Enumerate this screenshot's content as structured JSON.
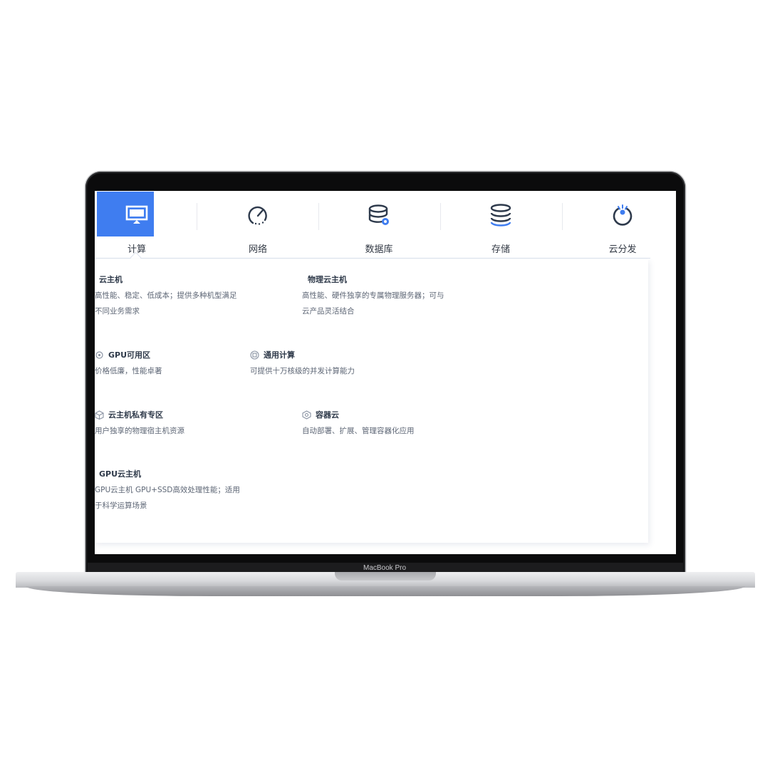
{
  "device": {
    "label": "MacBook Pro"
  },
  "tabs": [
    {
      "label": "计算",
      "icon": "monitor-icon",
      "active": true
    },
    {
      "label": "网络",
      "icon": "gauge-icon",
      "active": false
    },
    {
      "label": "数据库",
      "icon": "database-icon",
      "active": false
    },
    {
      "label": "存储",
      "icon": "storage-icon",
      "active": false
    },
    {
      "label": "云分发",
      "icon": "power-icon",
      "active": false
    }
  ],
  "products": {
    "cvm": {
      "title": "云主机",
      "desc1": "高性能、稳定、低成本；提供多种机型满足",
      "desc2": "不同业务需求"
    },
    "bare_metal": {
      "title": "物理云主机",
      "desc1": "高性能、硬件独享的专属物理服务器；可与",
      "desc2": "云产品灵活结合"
    },
    "gpu_zone": {
      "title": "GPU可用区",
      "desc": "价格低廉，性能卓著",
      "icon": "chip-icon"
    },
    "general_compute": {
      "title": "通用计算",
      "desc": "可提供十万核级的并发计算能力",
      "icon": "cpu-icon"
    },
    "private_zone": {
      "title": "云主机私有专区",
      "desc": "用户独享的物理宿主机资源",
      "icon": "cube-icon"
    },
    "container": {
      "title": "容器云",
      "desc": "自动部署、扩展、管理容器化应用",
      "icon": "container-icon"
    },
    "gpu_cvm": {
      "title": "GPU云主机",
      "desc1": "GPU云主机 GPU+SSD高效处理性能；适用",
      "desc2": "于科学运算场景"
    }
  },
  "colors": {
    "accent": "#3f7df0",
    "icon_stroke": "#2e3a4c",
    "text": "#333a45"
  }
}
